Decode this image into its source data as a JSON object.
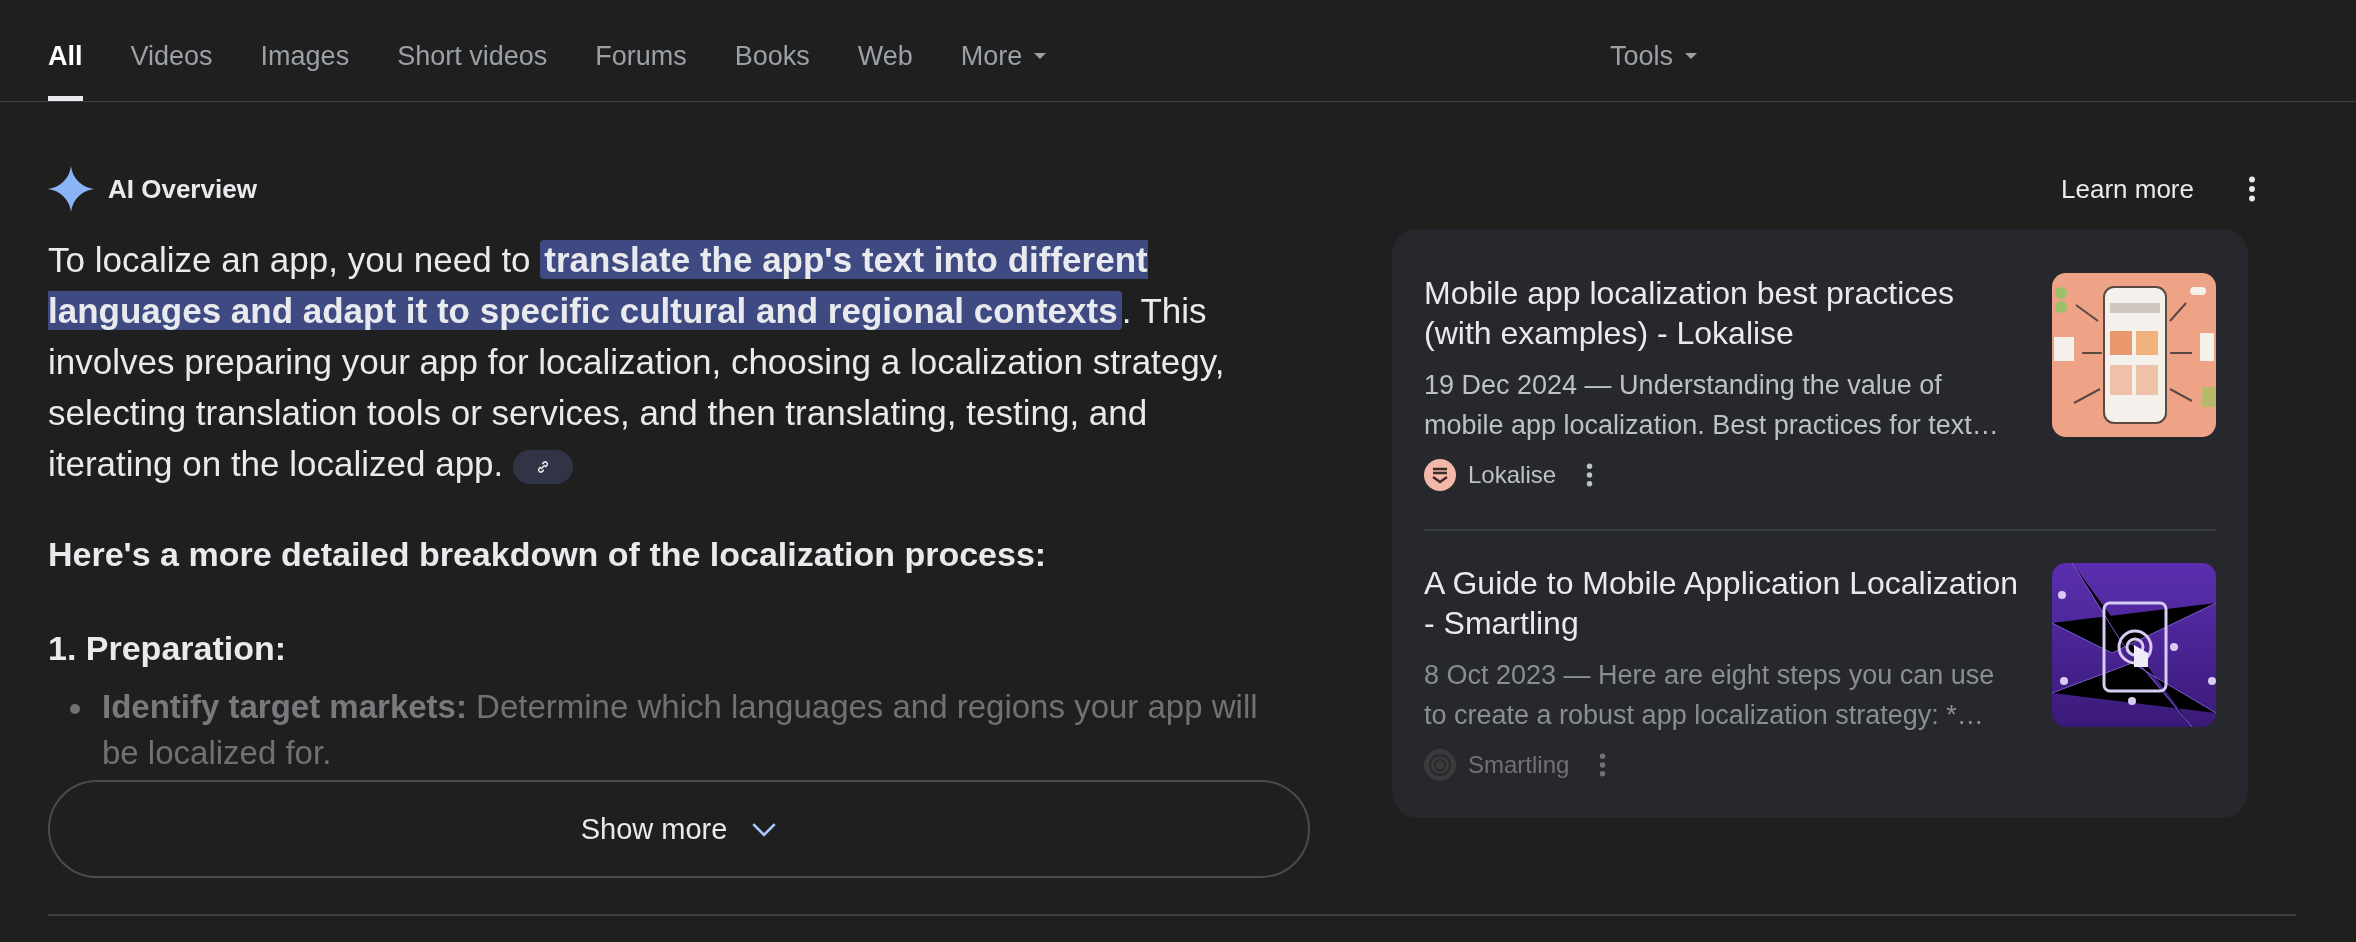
{
  "tabs": [
    {
      "label": "All",
      "selected": true
    },
    {
      "label": "Videos",
      "selected": false
    },
    {
      "label": "Images",
      "selected": false
    },
    {
      "label": "Short videos",
      "selected": false
    },
    {
      "label": "Forums",
      "selected": false
    },
    {
      "label": "Books",
      "selected": false
    },
    {
      "label": "Web",
      "selected": false
    },
    {
      "label": "More",
      "selected": false,
      "kind": "dropdown"
    }
  ],
  "tools": {
    "label": "Tools"
  },
  "overview": {
    "title": "AI Overview",
    "learn_more": "Learn more",
    "intro": [
      {
        "kind": "plain",
        "text": "To localize an app, you need to "
      },
      {
        "kind": "highlight",
        "text": "translate the app's text into different languages and adapt it to specific cultural and regional contexts"
      },
      {
        "kind": "plain",
        "text": ". This involves preparing your app for localization, choosing a localization strategy, selecting translation tools or services, and then translating, testing, and iterating on the localized app."
      }
    ],
    "lead": "Here's a more detailed breakdown of the localization process:",
    "section": "1. Preparation:",
    "bullets": [
      {
        "text": "**Identify target markets:** Determine which languages and regions your app will be localized for."
      }
    ],
    "show_more": "Show more"
  },
  "sources": [
    {
      "title": "Mobile app localization best practices (with examples) - Lokalise",
      "snippet": "19 Dec 2024 — Understanding the value of mobile app localization. Best practices for text…",
      "site": "Lokalise",
      "faded": false
    },
    {
      "title": "A Guide to Mobile Application Localization - Smartling",
      "snippet": "8 Oct 2023 — Here are eight steps you can use to create a robust app localization strategy: *…",
      "site": "Smartling",
      "faded": true
    }
  ]
}
